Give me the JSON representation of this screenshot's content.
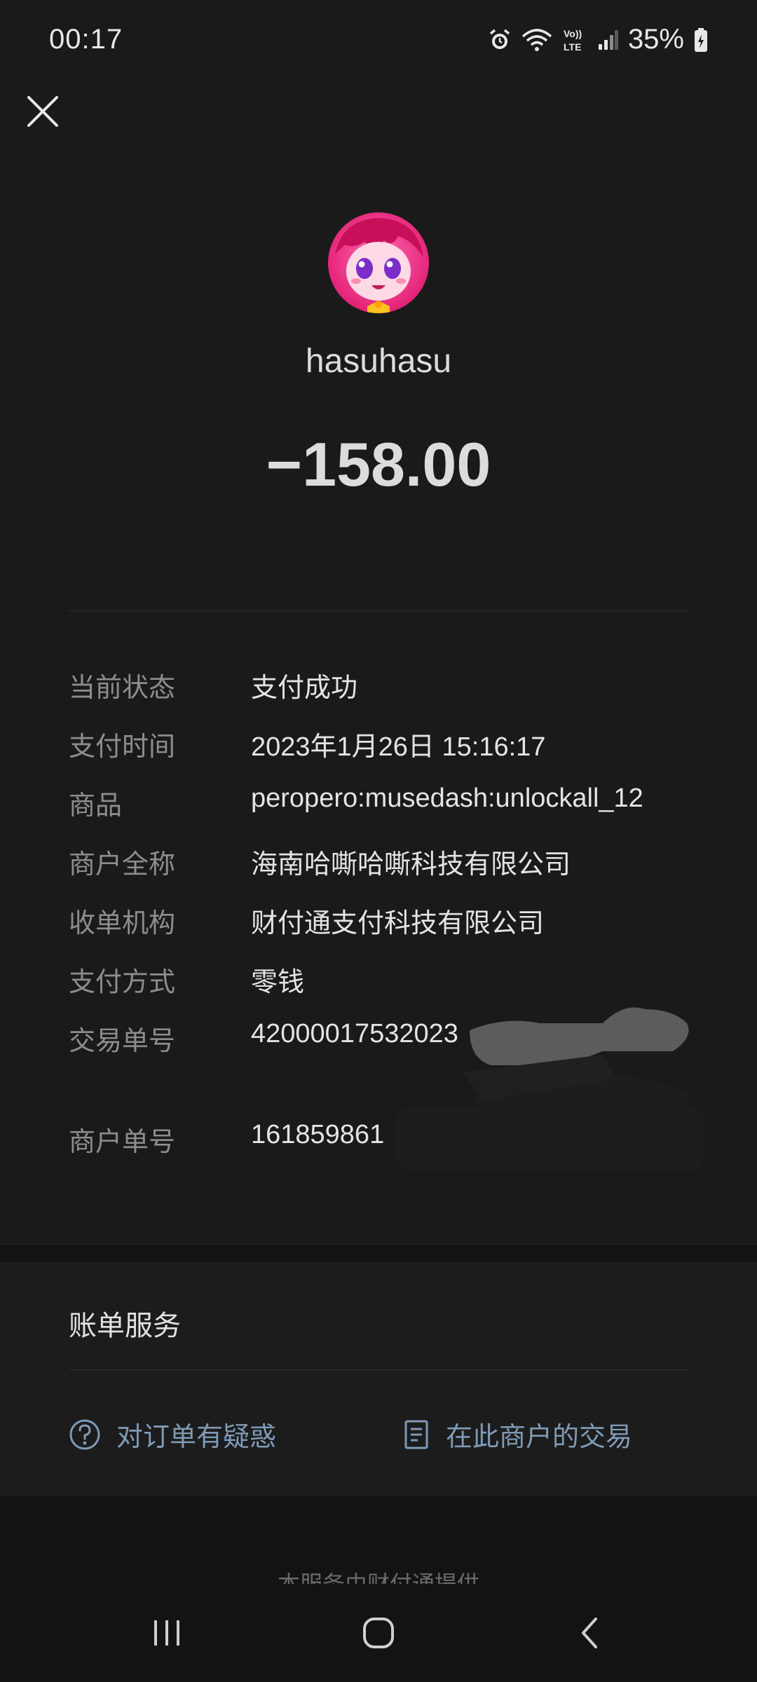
{
  "status_bar": {
    "time": "00:17",
    "battery": "35%",
    "icons": [
      "alarm-icon",
      "wifi-icon",
      "volte-lte-icon",
      "signal-icon",
      "battery-icon"
    ]
  },
  "header": {
    "merchant_name": "hasuhasu",
    "amount": "−158.00"
  },
  "details": [
    {
      "label": "当前状态",
      "value": "支付成功"
    },
    {
      "label": "支付时间",
      "value": "2023年1月26日 15:16:17"
    },
    {
      "label": "商品",
      "value": "peropero:musedash:unlockall_12"
    },
    {
      "label": "商户全称",
      "value": "海南哈嘶哈嘶科技有限公司"
    },
    {
      "label": "收单机构",
      "value": "财付通支付科技有限公司"
    },
    {
      "label": "支付方式",
      "value": "零钱"
    },
    {
      "label": "交易单号",
      "value": "42000017532023"
    },
    {
      "label": "商户单号",
      "value": "161859861"
    }
  ],
  "bill_service": {
    "title": "账单服务",
    "question_label": "对订单有疑惑",
    "merchant_tx_label": "在此商户的交易"
  },
  "footer": {
    "text": "本服务由财付通提供"
  },
  "colors": {
    "background": "#1a1a1a",
    "link": "#7f9ab6",
    "label": "#8d8d8d"
  }
}
